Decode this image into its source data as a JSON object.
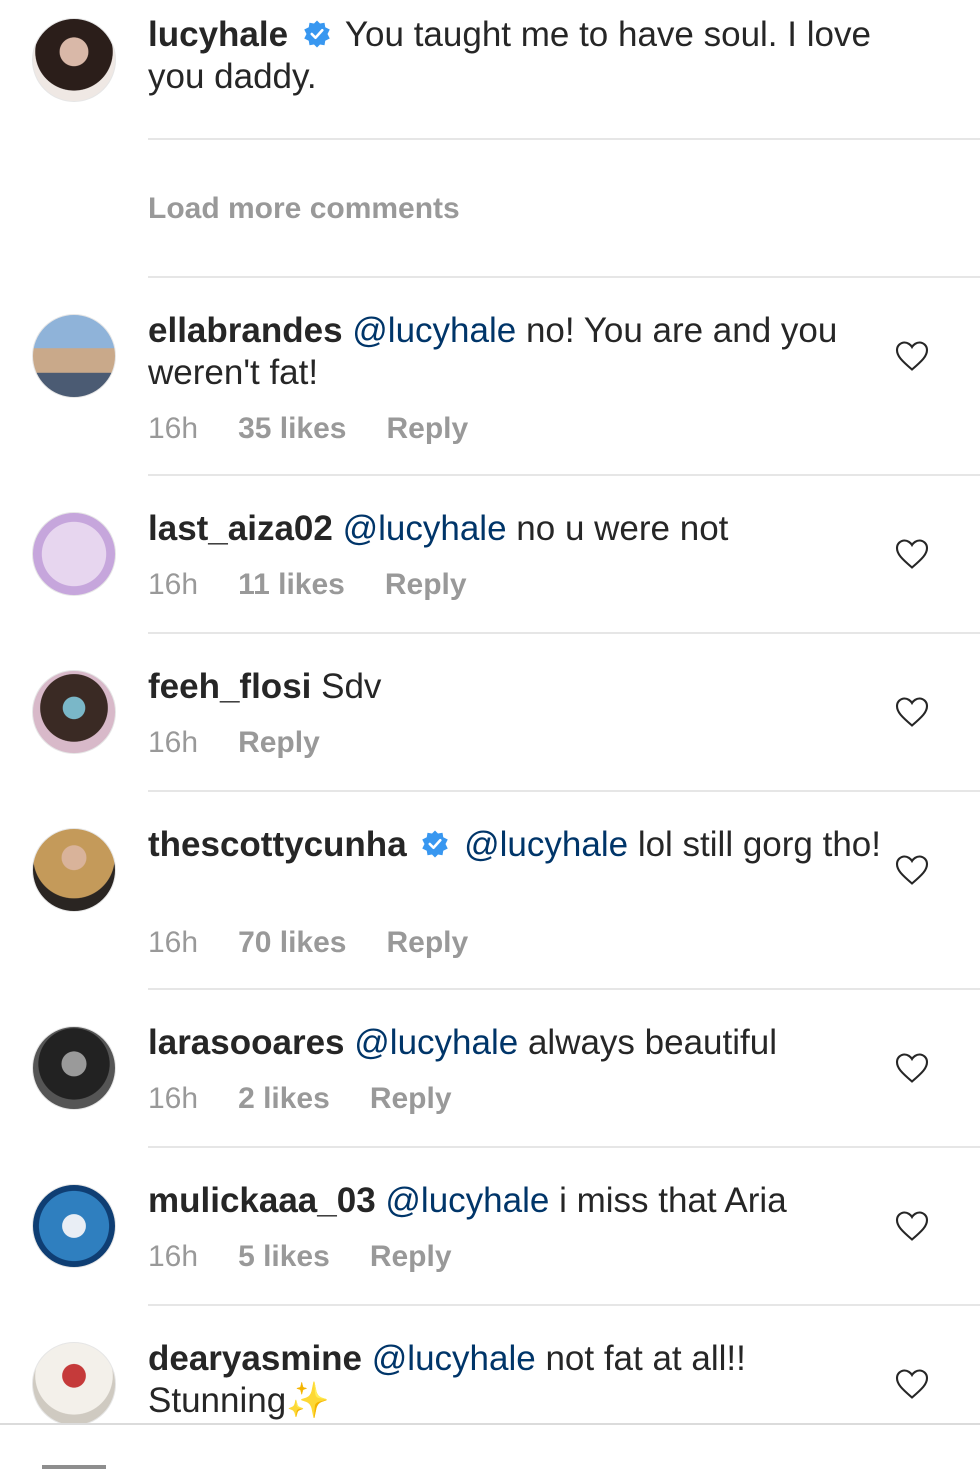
{
  "caption": {
    "username": "lucyhale",
    "verified": true,
    "text": "You taught me to have soul. I love you daddy."
  },
  "load_more_label": "Load more comments",
  "comments": [
    {
      "username": "ellabrandes",
      "verified": false,
      "mention": "@lucyhale",
      "text": "no! You are and you weren't fat!",
      "time": "16h",
      "likes": "35 likes",
      "reply": "Reply"
    },
    {
      "username": "last_aiza02",
      "verified": false,
      "mention": "@lucyhale",
      "text": "no u were not",
      "time": "16h",
      "likes": "11 likes",
      "reply": "Reply"
    },
    {
      "username": "feeh_flosi",
      "verified": false,
      "mention": "",
      "text": "Sdv",
      "time": "16h",
      "likes": "",
      "reply": "Reply"
    },
    {
      "username": "thescottycunha",
      "verified": true,
      "mention": "@lucyhale",
      "text": "lol still gorg tho!",
      "time": "16h",
      "likes": "70 likes",
      "reply": "Reply"
    },
    {
      "username": "larasooares",
      "verified": false,
      "mention": "@lucyhale",
      "text": "always beautiful",
      "time": "16h",
      "likes": "2 likes",
      "reply": "Reply"
    },
    {
      "username": "mulickaaa_03",
      "verified": false,
      "mention": "@lucyhale",
      "text": "i miss that Aria",
      "time": "16h",
      "likes": "5 likes",
      "reply": "Reply"
    },
    {
      "username": "dearyasmine",
      "verified": false,
      "mention": "@lucyhale",
      "text": "not fat at all!! Stunning✨",
      "time": "",
      "likes": "",
      "reply": ""
    }
  ],
  "colors": {
    "username": "#262626",
    "mention": "#003569",
    "meta": "#999999",
    "verified": "#3897f0",
    "divider": "#e6e6e6"
  },
  "icons": [
    "verified-badge-icon",
    "heart-icon"
  ]
}
